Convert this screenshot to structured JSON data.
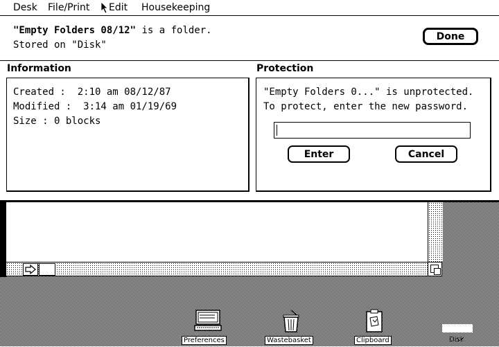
{
  "menubar": {
    "items": [
      "Desk",
      "File/Print",
      "Edit",
      "Housekeeping"
    ]
  },
  "dialog": {
    "item_name": "\"Empty Folders 08/12\"",
    "item_kind": " is a folder.",
    "stored_on": "Stored on \"Disk\"",
    "done_label": "Done",
    "information": {
      "title": "Information",
      "created": "Created :  2:10 am 08/12/87",
      "modified": "Modified :  3:14 am 01/19/69",
      "size": "Size : 0 blocks"
    },
    "protection": {
      "title": "Protection",
      "status": "\"Empty Folders 0...\" is unprotected.",
      "instruction": "To protect, enter the new password.",
      "password_value": "",
      "enter_label": "Enter",
      "cancel_label": "Cancel"
    }
  },
  "desktop": {
    "icons": [
      "Preferences",
      "Wastebasket",
      "Clipboard",
      "Disk"
    ]
  }
}
